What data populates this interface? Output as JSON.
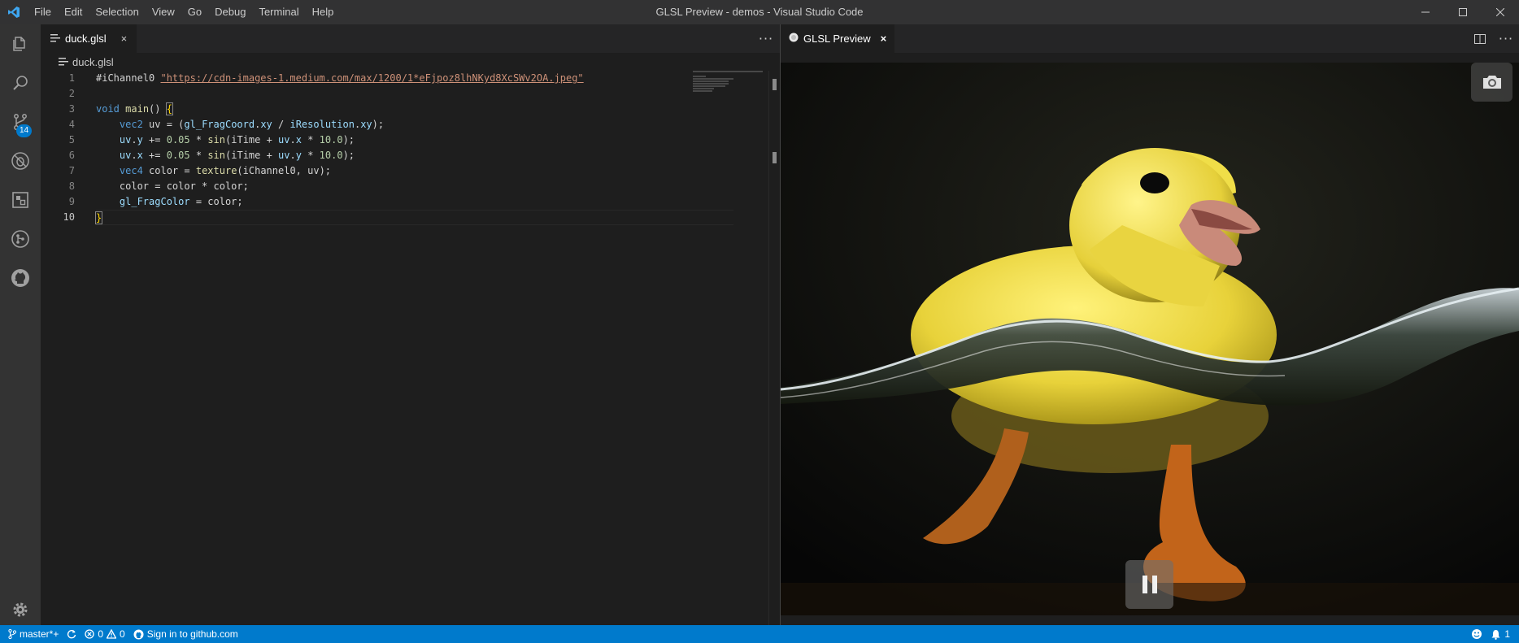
{
  "window": {
    "title": "GLSL Preview - demos - Visual Studio Code",
    "menu": [
      "File",
      "Edit",
      "Selection",
      "View",
      "Go",
      "Debug",
      "Terminal",
      "Help"
    ]
  },
  "activity_bar": {
    "items": [
      "explorer-icon",
      "search-icon",
      "source-control-icon",
      "debug-icon",
      "extensions-icon",
      "gitlens-icon",
      "github-icon"
    ],
    "source_control_badge": "14",
    "settings": "gear-icon"
  },
  "editor": {
    "tab_label": "duck.glsl",
    "breadcrumb": "duck.glsl",
    "line_numbers": [
      "1",
      "2",
      "3",
      "4",
      "5",
      "6",
      "7",
      "8",
      "9",
      "10"
    ],
    "lines": [
      "#iChannel0 \"https://cdn-images-1.medium.com/max/1200/1*eFjpoz8lhNKyd8XcSWv2OA.jpeg\"",
      "",
      "void main() {",
      "    vec2 uv = (gl_FragCoord.xy / iResolution.xy);",
      "    uv.y += 0.05 * sin(iTime + uv.x * 10.0);",
      "    uv.x += 0.05 * sin(iTime + uv.y * 10.0);",
      "    vec4 color = texture(iChannel0, uv);",
      "    color = color * color;",
      "    gl_FragColor = color;",
      "}"
    ],
    "active_line": "10",
    "tokens": {
      "directive": "#iChannel0",
      "url": "\"https://cdn-images-1.medium.com/max/1200/1*eFjpoz8lhNKyd8XcSWv2OA.jpeg\""
    }
  },
  "preview": {
    "tab_label": "GLSL Preview",
    "close_glyph": "×",
    "image_subject": "yellow duckling swimming in rippling water",
    "camera_button": "camera-icon",
    "pause_button": "pause-icon"
  },
  "status_bar": {
    "branch": "master*+",
    "errors": "0",
    "warnings": "0",
    "github": "Sign in to github.com",
    "notifications": "1"
  },
  "colors": {
    "accent": "#007acc",
    "titlebar": "#323233",
    "activitybar": "#333333",
    "editor_bg": "#1e1e1e",
    "tabbar": "#252526"
  }
}
